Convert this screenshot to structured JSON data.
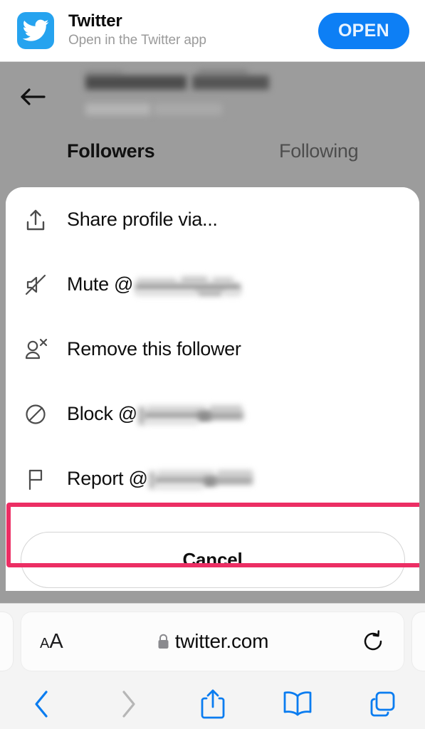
{
  "smart_banner": {
    "app_name": "Twitter",
    "subtitle": "Open in the Twitter app",
    "open_label": "OPEN",
    "icon": "twitter-bird-icon",
    "icon_bg": "#26a3ef",
    "open_bg": "#0d7ff5"
  },
  "profile_page": {
    "back_icon": "back-arrow-icon",
    "display_name_redacted": true,
    "handle_redacted": true,
    "tabs": [
      {
        "label": "Followers",
        "selected": true
      },
      {
        "label": "Following",
        "selected": false
      }
    ],
    "overlay_color": "#9c9c9c"
  },
  "action_sheet": {
    "items": [
      {
        "id": "share-profile",
        "icon": "share-up-arrow-icon",
        "label": "Share profile via...",
        "redacted_handle": false,
        "highlighted": false
      },
      {
        "id": "mute-user",
        "icon": "mute-speaker-icon",
        "label": "Mute @",
        "redacted_handle": true,
        "handle_width": 153,
        "highlighted": false
      },
      {
        "id": "remove-follower",
        "icon": "person-remove-icon",
        "label": "Remove this follower",
        "redacted_handle": false,
        "highlighted": true
      },
      {
        "id": "block-user",
        "icon": "block-circle-slash-icon",
        "label": "Block @",
        "redacted_handle": true,
        "handle_width": 150,
        "highlighted": false
      },
      {
        "id": "report-user",
        "icon": "report-flag-icon",
        "label": "Report @",
        "redacted_handle": true,
        "handle_width": 148,
        "highlighted": false
      }
    ],
    "cancel_label": "Cancel",
    "highlight_color": "#ec2e64"
  },
  "browser": {
    "text_size_small": "A",
    "text_size_large": "A",
    "lock_icon": "lock-icon",
    "url": "twitter.com",
    "reload_icon": "reload-icon",
    "toolbar": [
      {
        "id": "back",
        "icon": "chevron-left-icon",
        "enabled": true
      },
      {
        "id": "forward",
        "icon": "chevron-right-icon",
        "enabled": false
      },
      {
        "id": "share",
        "icon": "share-icon",
        "enabled": true
      },
      {
        "id": "bookmarks",
        "icon": "book-icon",
        "enabled": true
      },
      {
        "id": "tabs",
        "icon": "tabs-icon",
        "enabled": true
      }
    ],
    "accent_color": "#0a7cf0",
    "disabled_color": "#b6b6b6"
  }
}
